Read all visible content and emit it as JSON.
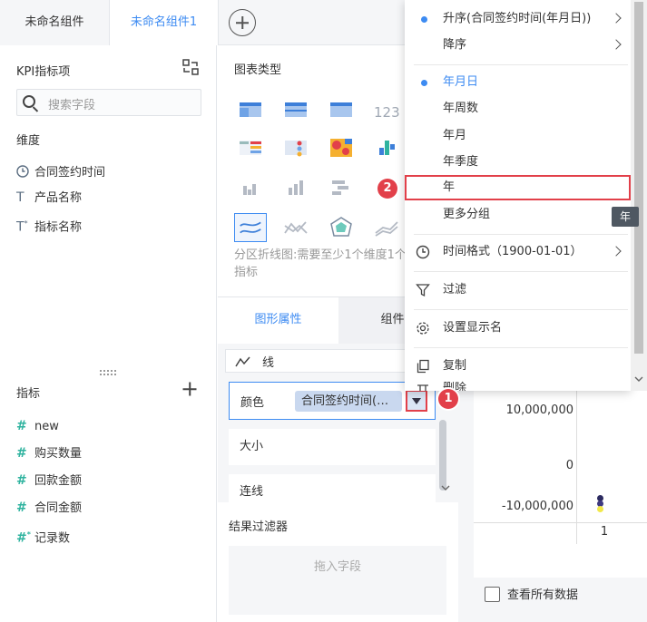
{
  "tabs": [
    "未命名组件",
    "未命名组件1"
  ],
  "left": {
    "kpi_title": "KPI指标项",
    "search_placeholder": "搜索字段",
    "dimension_title": "维度",
    "dimensions": [
      "合同签约时间",
      "产品名称",
      "指标名称"
    ],
    "metric_title": "指标",
    "metrics": [
      "new",
      "购买数量",
      "回款金额",
      "合同金额",
      "记录数"
    ]
  },
  "middle": {
    "chart_type_title": "图表类型",
    "chart_desc": "分区折线图:需要至少1个维度1个指标",
    "prop_tabs": [
      "图形属性",
      "组件样"
    ],
    "line_label": "线",
    "color_label": "颜色",
    "color_field": "合同签约时间(…",
    "size_label": "大小",
    "connect_label": "连线",
    "filter_title": "结果过滤器",
    "drop_hint": "拖入字段"
  },
  "chart": {
    "y_ticks": [
      "10,000,000",
      "0",
      "-10,000,000"
    ],
    "x_tick": "1",
    "see_all": "查看所有数据"
  },
  "menu": {
    "sort_asc": "升序(合同签约时间(年月日))",
    "sort_desc": "降序",
    "groups": [
      "年月日",
      "年周数",
      "年月",
      "年季度",
      "年",
      "更多分组"
    ],
    "time_format": "时间格式（1900-01-01）",
    "filter": "过滤",
    "set_name": "设置显示名",
    "copy": "复制",
    "delete": "删除",
    "tooltip": "年"
  },
  "badges": [
    "1",
    "2"
  ],
  "colors": {
    "accent": "#3d8bf2",
    "highlight": "#e2404a",
    "teal": "#2fb39f"
  }
}
